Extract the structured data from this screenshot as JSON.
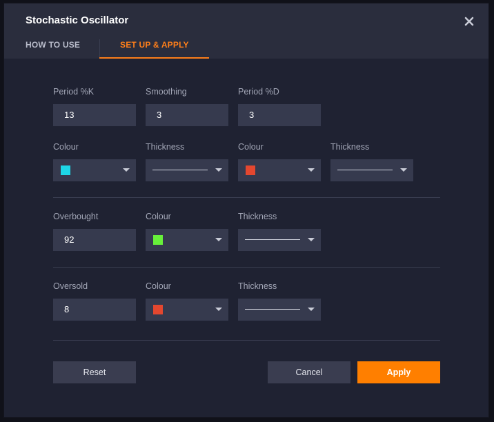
{
  "dialog": {
    "title": "Stochastic Oscillator",
    "close_icon": "close-icon"
  },
  "tabs": [
    {
      "label": "HOW TO USE",
      "active": false
    },
    {
      "label": "SET UP & APPLY",
      "active": true
    }
  ],
  "colors": {
    "accent": "#ff7f00",
    "k_line": "#1ed6e6",
    "d_line": "#e4472f",
    "overbought": "#67f03a",
    "oversold": "#e4472f"
  },
  "period": {
    "k_label": "Period %K",
    "k_value": "13",
    "smoothing_label": "Smoothing",
    "smoothing_value": "3",
    "d_label": "Period %D",
    "d_value": "3"
  },
  "lines": {
    "k_colour_label": "Colour",
    "k_thickness_label": "Thickness",
    "d_colour_label": "Colour",
    "d_thickness_label": "Thickness"
  },
  "overbought": {
    "label": "Overbought",
    "value": "92",
    "colour_label": "Colour",
    "thickness_label": "Thickness"
  },
  "oversold": {
    "label": "Oversold",
    "value": "8",
    "colour_label": "Colour",
    "thickness_label": "Thickness"
  },
  "buttons": {
    "reset": "Reset",
    "cancel": "Cancel",
    "apply": "Apply"
  }
}
